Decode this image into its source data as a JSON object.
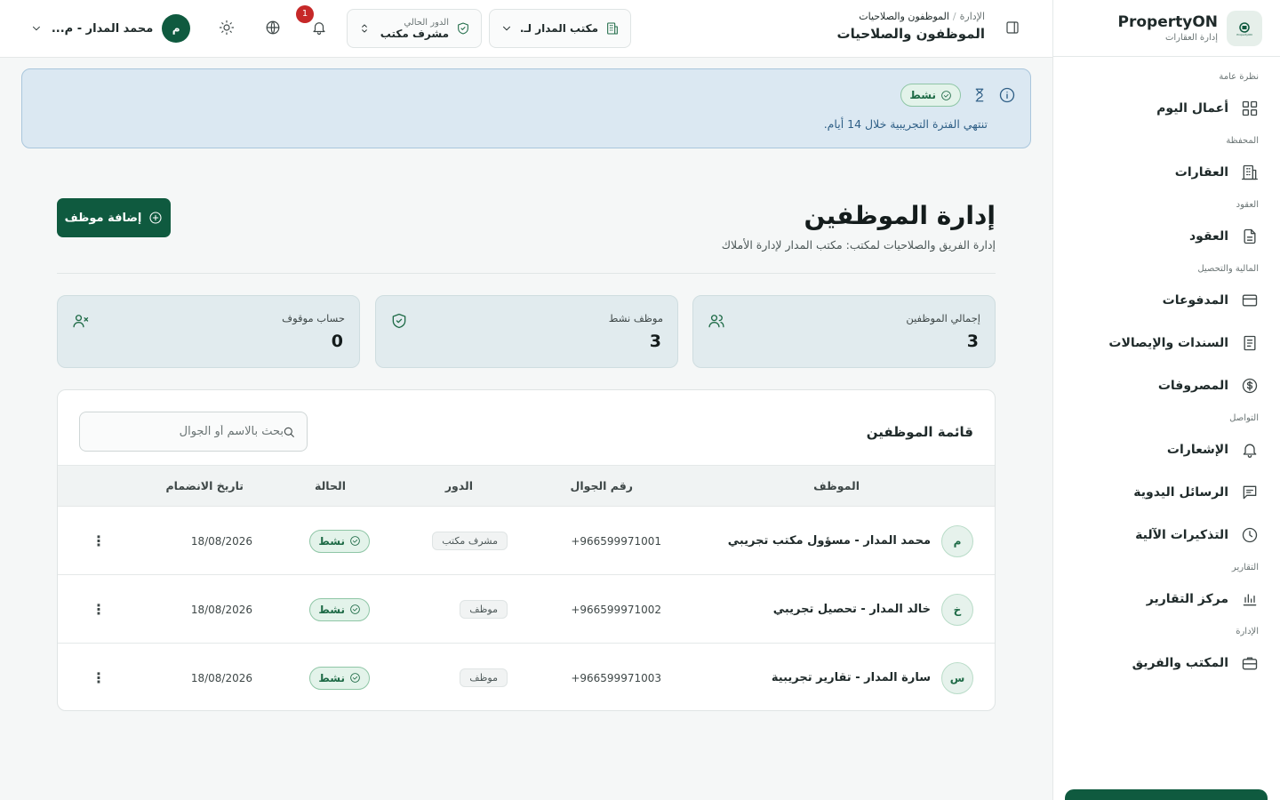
{
  "brand": {
    "name": "PropertyON",
    "subtitle": "إدارة العقارات",
    "logo_text": "PropertyON"
  },
  "sidebar": {
    "sections": [
      {
        "title": "نظرة عامة",
        "items": [
          {
            "label": "أعمال اليوم",
            "icon": "grid-icon"
          }
        ]
      },
      {
        "title": "المحفظة",
        "items": [
          {
            "label": "العقارات",
            "icon": "building-icon"
          }
        ]
      },
      {
        "title": "العقود",
        "items": [
          {
            "label": "العقود",
            "icon": "document-icon"
          }
        ]
      },
      {
        "title": "المالية والتحصيل",
        "items": [
          {
            "label": "المدفوعات",
            "icon": "wallet-icon"
          },
          {
            "label": "السندات والإيصالات",
            "icon": "receipt-icon"
          },
          {
            "label": "المصروفات",
            "icon": "dollar-circle-icon"
          }
        ]
      },
      {
        "title": "التواصل",
        "items": [
          {
            "label": "الإشعارات",
            "icon": "bell-icon"
          },
          {
            "label": "الرسائل اليدوية",
            "icon": "message-icon"
          },
          {
            "label": "التذكيرات الآلية",
            "icon": "clock-icon"
          }
        ]
      },
      {
        "title": "التقارير",
        "items": [
          {
            "label": "مركز التقارير",
            "icon": "bar-chart-icon"
          }
        ]
      },
      {
        "title": "الإدارة",
        "items": [
          {
            "label": "المكتب والفريق",
            "icon": "briefcase-icon"
          }
        ]
      }
    ]
  },
  "header": {
    "breadcrumb": {
      "parent": "الإدارة",
      "current": "الموظفون والصلاحيات"
    },
    "title": "الموظفون والصلاحيات",
    "office_select": {
      "value": "مكتب المدار لـ..."
    },
    "role_select": {
      "label": "الدور الحالي",
      "value": "مشرف مكتب"
    },
    "notifications_count": "1",
    "user": {
      "initial": "م",
      "name": "محمد المدار - م..."
    }
  },
  "banner": {
    "status": "نشط",
    "message": "تنتهي الفترة التجريبية خلال 14 أيام."
  },
  "page": {
    "title": "إدارة الموظفين",
    "subtitle": "إدارة الفريق والصلاحيات لمكتب: مكتب المدار لإدارة الأملاك",
    "add_button": "إضافة موظف"
  },
  "stats": [
    {
      "label": "إجمالي الموظفين",
      "value": "3",
      "icon": "users-icon"
    },
    {
      "label": "موظف نشط",
      "value": "3",
      "icon": "shield-check-icon"
    },
    {
      "label": "حساب موقوف",
      "value": "0",
      "icon": "user-x-icon"
    }
  ],
  "table": {
    "title": "قائمة الموظفين",
    "search_placeholder": "بحث بالاسم أو الجوال",
    "columns": {
      "employee": "الموظف",
      "phone": "رقم الجوال",
      "role": "الدور",
      "status": "الحالة",
      "joined": "تاريخ الانضمام"
    },
    "rows": [
      {
        "initial": "م",
        "name": "محمد المدار - مسؤول مكتب تجريبي",
        "phone": "+966599971001",
        "role": "مشرف مكتب",
        "status": "نشط",
        "joined": "18/08/2026"
      },
      {
        "initial": "خ",
        "name": "خالد المدار - تحصيل تجريبي",
        "phone": "+966599971002",
        "role": "موظف",
        "status": "نشط",
        "joined": "18/08/2026"
      },
      {
        "initial": "س",
        "name": "سارة المدار - تقارير تجريبية",
        "phone": "+966599971003",
        "role": "موظف",
        "status": "نشط",
        "joined": "18/08/2026"
      }
    ]
  },
  "colors": {
    "primary": "#0f5a3f",
    "banner_bg": "#dbe8f2",
    "stat_bg": "#e1ebee",
    "badge_red": "#c62828"
  }
}
